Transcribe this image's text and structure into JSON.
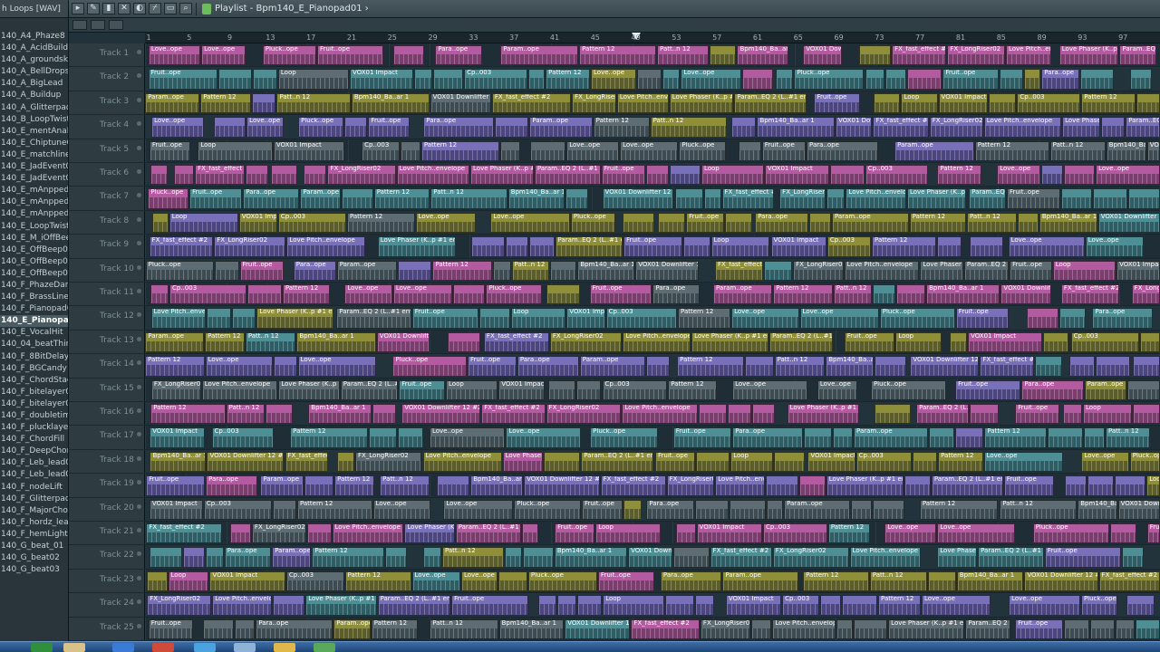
{
  "browser": {
    "header": "h Loops [WAV]",
    "items": [
      "140_A4_Phaze8",
      "140_A_AcidBuildup",
      "140_A_groundsky",
      "140_A_BellDrops",
      "140_A_BigLead",
      "140_A_Buildup",
      "140_A_Glitterpad",
      "140_B_LoopTwisted",
      "140_E_mentAnalog",
      "140_E_ChiptuneOff",
      "140_E_matchlines",
      "140_E_JadEvent01",
      "140_E_JadEvent03",
      "140_E_mAnpped01",
      "140_E_mAnpped02",
      "140_E_mAnpped03",
      "140_E_LoopTwisted",
      "140_E_M_iOffBeep",
      "140_E_OffBeep01",
      "140_E_OffBeep03",
      "140_E_OffBeep05",
      "140_F_PhazeDance",
      "140_F_BrassLine",
      "140_F_Pianopad01",
      "140_E_Pianopad02",
      "140_E_VocalHit",
      "140_04_beatThings",
      "140_F_8BitDelay",
      "140_F_BGCandy",
      "140_F_ChordStack",
      "140_F_bitelayer01",
      "140_F_bitelayer03",
      "140_F_doubletime",
      "140_F_plucklayer",
      "140_F_ChordFill",
      "140_F_DeepChords",
      "140_F_Leb_lead01",
      "140_F_Leb_lead02",
      "140_F_nodeLift",
      "140_F_Glitterpad",
      "140_F_MajorChords",
      "140_F_hordz_lead",
      "140_F_hemLight",
      "140_G_beat_01",
      "140_G_beat02",
      "140_G_beat03"
    ],
    "selected_index": 24
  },
  "playlist": {
    "title": "Playlist - Bpm140_E_Pianopad01 ›",
    "snap": "Line",
    "playhead_bar": 49,
    "ruler": [
      "1",
      "5",
      "9",
      "13",
      "17",
      "21",
      "25",
      "29",
      "33",
      "37",
      "41",
      "45",
      "49",
      "53",
      "57",
      "61",
      "65",
      "69",
      "73",
      "77",
      "81",
      "85",
      "89",
      "93",
      "97"
    ],
    "tracks": [
      "Track 1",
      "Track 2",
      "Track 3",
      "Track 4",
      "Track 5",
      "Track 6",
      "Track 7",
      "Track 8",
      "Track 9",
      "Track 10",
      "Track 11",
      "Track 12",
      "Track 13",
      "Track 14",
      "Track 15",
      "Track 16",
      "Track 17",
      "Track 18",
      "Track 19",
      "Track 20",
      "Track 21",
      "Track 22",
      "Track 23",
      "Track 24",
      "Track 25"
    ],
    "clip_labels": [
      "Love..ope",
      "Love..ope",
      "Pluck..ope",
      "Fruit..ope",
      "Para..ope",
      "Param..ope",
      "Pattern 12",
      "Patt..n 12",
      "Bpm140_Ba..ar 1",
      "VOX01 Downlifter 12 #2",
      "FX_fast_effect #2",
      "FX_LongRiser02",
      "Love Pitch..envelope",
      "Love Phaser (K..p #1 envelope",
      "Param..EQ 2 (L..#1 envelope",
      "Fruit..ope",
      "Loop",
      "VOX01 Impact",
      "Cp..003",
      "Pattern 12"
    ],
    "colors": {
      "pink": "#b45aa0",
      "teal": "#4e8f96",
      "olive": "#8f8f3a",
      "violet": "#7870b8",
      "grey": "#5e6d74"
    }
  }
}
